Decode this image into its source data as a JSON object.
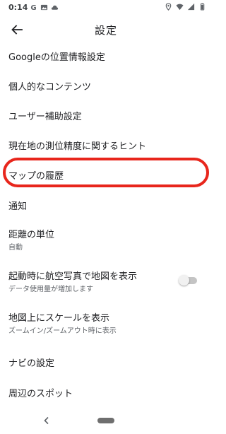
{
  "status_bar": {
    "time": "0:14",
    "left_icons": [
      "g-icon",
      "photo-icon",
      "cloud-icon"
    ],
    "right_icons": [
      "location-icon",
      "wifi-icon",
      "signal-icon",
      "battery-icon"
    ]
  },
  "app_bar": {
    "title": "設定",
    "back_icon": "arrow-back-icon"
  },
  "settings": {
    "items": [
      {
        "title": "Googleの位置情報設定",
        "subtitle": ""
      },
      {
        "title": "個人的なコンテンツ",
        "subtitle": ""
      },
      {
        "title": "ユーザー補助設定",
        "subtitle": ""
      },
      {
        "title": "現在地の測位精度に関するヒント",
        "subtitle": ""
      },
      {
        "title": "マップの履歴",
        "subtitle": ""
      },
      {
        "title": "通知",
        "subtitle": ""
      },
      {
        "title": "距離の単位",
        "subtitle": "自動"
      },
      {
        "title": "起動時に航空写真で地図を表示",
        "subtitle": "データ使用量が増加します",
        "toggle_on": false
      },
      {
        "title": "地図上にスケールを表示",
        "subtitle": "ズームイン/ズームアウト時に表示"
      },
      {
        "title": "ナビの設定",
        "subtitle": ""
      },
      {
        "title": "周辺のスポット",
        "subtitle": ""
      }
    ],
    "highlighted_item": "マップの履歴"
  },
  "colors": {
    "highlight": "#e8261c",
    "text_primary": "#202124",
    "text_secondary": "#5f6368"
  },
  "nav_bar": {
    "back_icon": "nav-back-icon",
    "home_icon": "home-pill-icon"
  }
}
